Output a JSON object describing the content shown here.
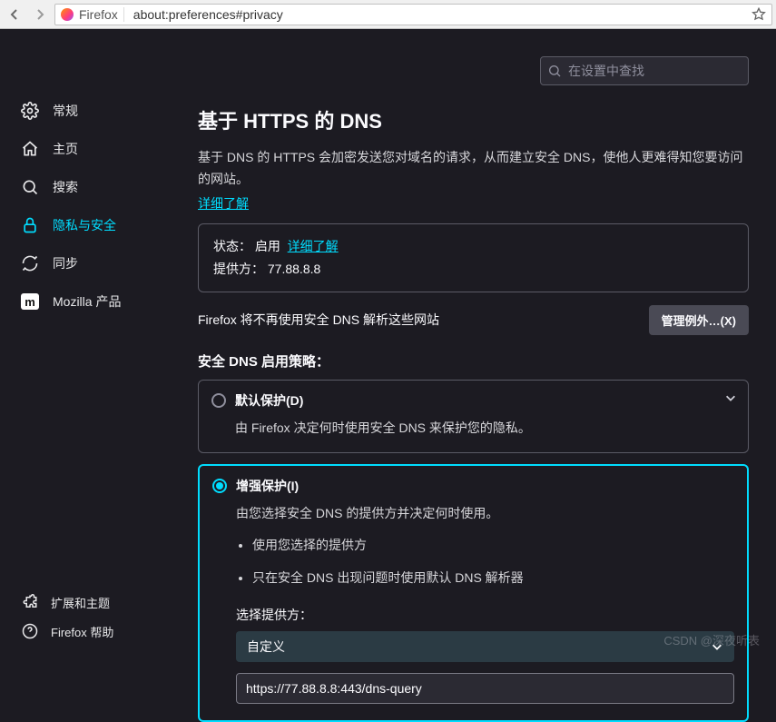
{
  "toolbar": {
    "browser_label": "Firefox",
    "url": "about:preferences#privacy"
  },
  "search": {
    "placeholder": "在设置中查找"
  },
  "sidebar": {
    "items": [
      {
        "label": "常规"
      },
      {
        "label": "主页"
      },
      {
        "label": "搜索"
      },
      {
        "label": "隐私与安全"
      },
      {
        "label": "同步"
      },
      {
        "label": "Mozilla 产品"
      }
    ],
    "bottom": [
      {
        "label": "扩展和主题"
      },
      {
        "label": "Firefox 帮助"
      }
    ]
  },
  "section": {
    "title": "基于 HTTPS 的 DNS",
    "desc": "基于 DNS 的 HTTPS 会加密发送您对域名的请求，从而建立安全 DNS，使他人更难得知您要访问的网站。",
    "learn_more": "详细了解",
    "status_label": "状态：",
    "status_value": "启用",
    "status_learn_more": "详细了解",
    "provider_label": "提供方：",
    "provider_value": "77.88.8.8",
    "exception_note": "Firefox 将不再使用安全 DNS 解析这些网站",
    "manage_exceptions": "管理例外…(X)",
    "policy_title": "安全 DNS 启用策略："
  },
  "policies": {
    "default": {
      "title": "默认保护(D)",
      "desc": "由 Firefox 决定何时使用安全 DNS 来保护您的隐私。"
    },
    "enhanced": {
      "title": "增强保护(I)",
      "desc": "由您选择安全 DNS 的提供方并决定何时使用。",
      "bullets": [
        "使用您选择的提供方",
        "只在安全 DNS 出现问题时使用默认 DNS 解析器"
      ],
      "select_label": "选择提供方：",
      "selected_option": "自定义",
      "custom_url": "https://77.88.8.8:443/dns-query"
    }
  },
  "watermark": "CSDN @深夜听表"
}
